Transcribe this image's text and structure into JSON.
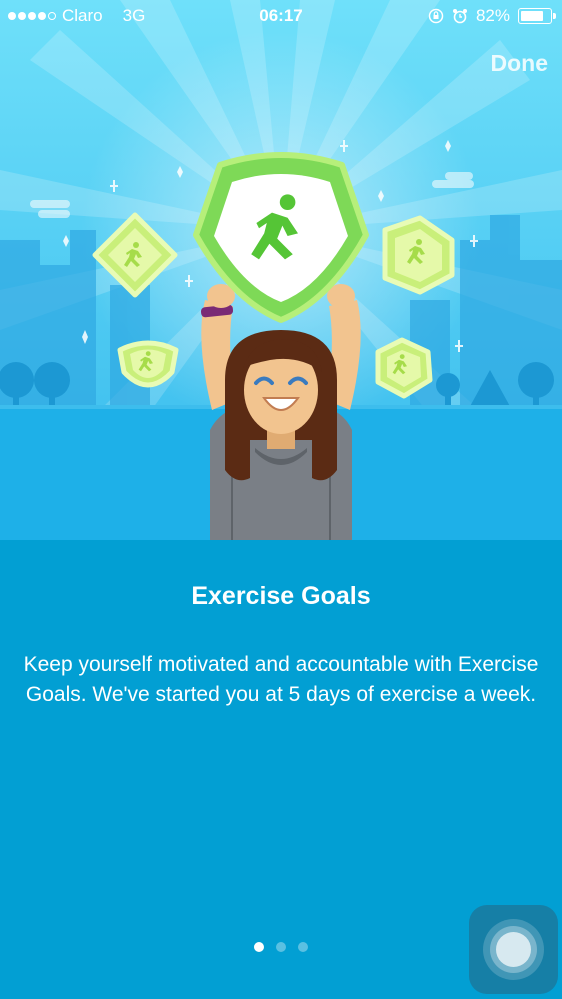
{
  "status_bar": {
    "carrier": "Claro",
    "network": "3G",
    "time": "06:17",
    "battery": "82%",
    "battery_level": 0.82,
    "icons": [
      "signal-dots-icon",
      "orientation-lock-icon",
      "alarm-icon",
      "battery-icon"
    ]
  },
  "header": {
    "done_label": "Done"
  },
  "onboarding": {
    "title": "Exercise Goals",
    "description": "Keep yourself motivated and accountable with Exercise Goals. We've started you at 5 days of exercise a week.",
    "page_count": 3,
    "current_page": 1
  },
  "colors": {
    "background": "#029fd3",
    "sky": "#5fd0f5",
    "badge_green": "#7ed957",
    "badge_light": "#d8f5a2"
  }
}
